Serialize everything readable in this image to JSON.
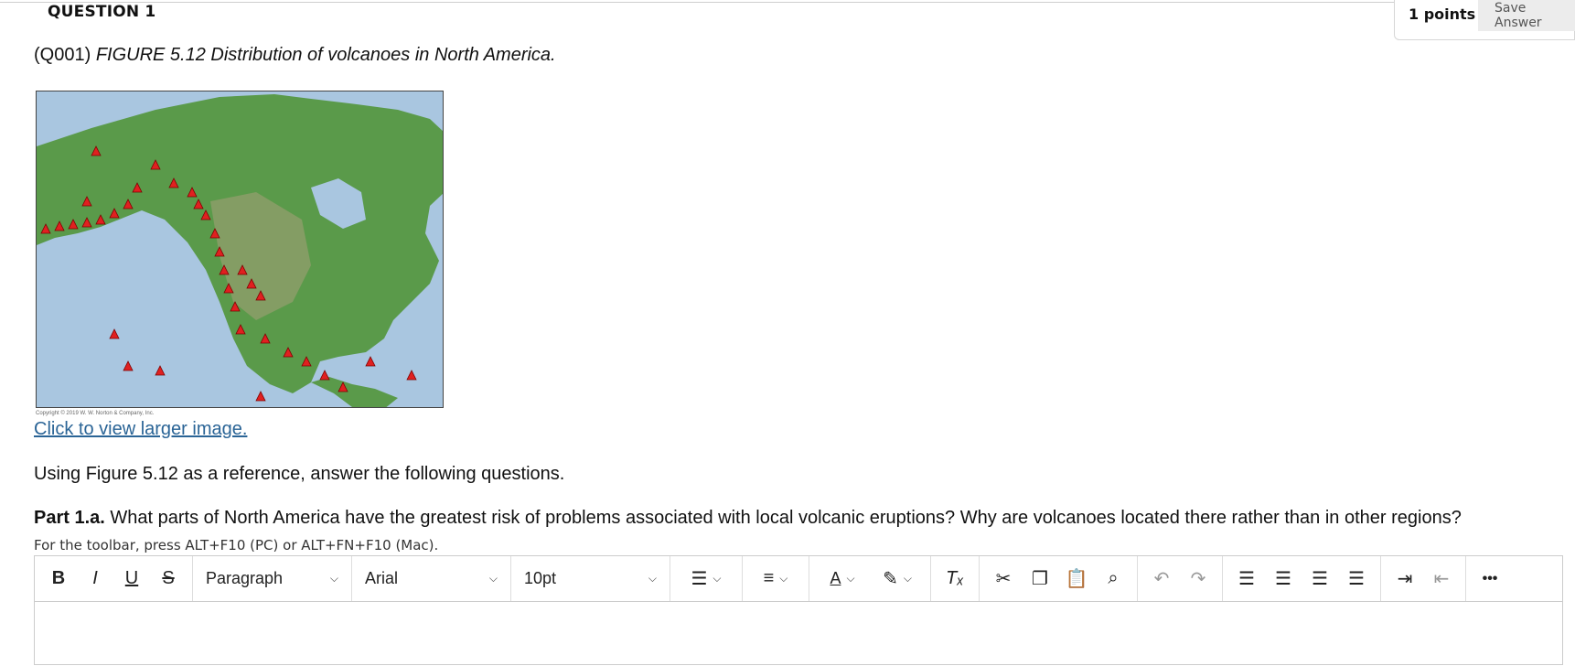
{
  "question": {
    "heading": "QUESTION 1",
    "points": "1 points",
    "save_label": "Save Answer",
    "id_label": "(Q001)",
    "figure_caption": "FIGURE 5.12 Distribution of volcanoes in North America.",
    "image_copyright": "Copyright © 2019 W. W. Norton & Company, Inc.",
    "larger_image_link": "Click to view larger image.",
    "instruction": "Using Figure 5.12 as a reference, answer the following questions.",
    "part_label": "Part 1.a.",
    "part_text": "What parts of North America have the greatest risk of problems associated with local volcanic eruptions? Why are volcanoes located there rather than in other regions?"
  },
  "editor": {
    "toolbar_hint": "For the toolbar, press ALT+F10 (PC) or ALT+FN+F10 (Mac).",
    "bold": "B",
    "italic": "I",
    "underline": "U",
    "strike": "S",
    "block_format": "Paragraph",
    "font_family": "Arial",
    "font_size": "10pt",
    "more": "•••",
    "content": ""
  },
  "colors": {
    "link": "#2a6496",
    "volcano": "#e02020",
    "ocean": "#a9c6e0",
    "land": "#5a9a4a"
  }
}
